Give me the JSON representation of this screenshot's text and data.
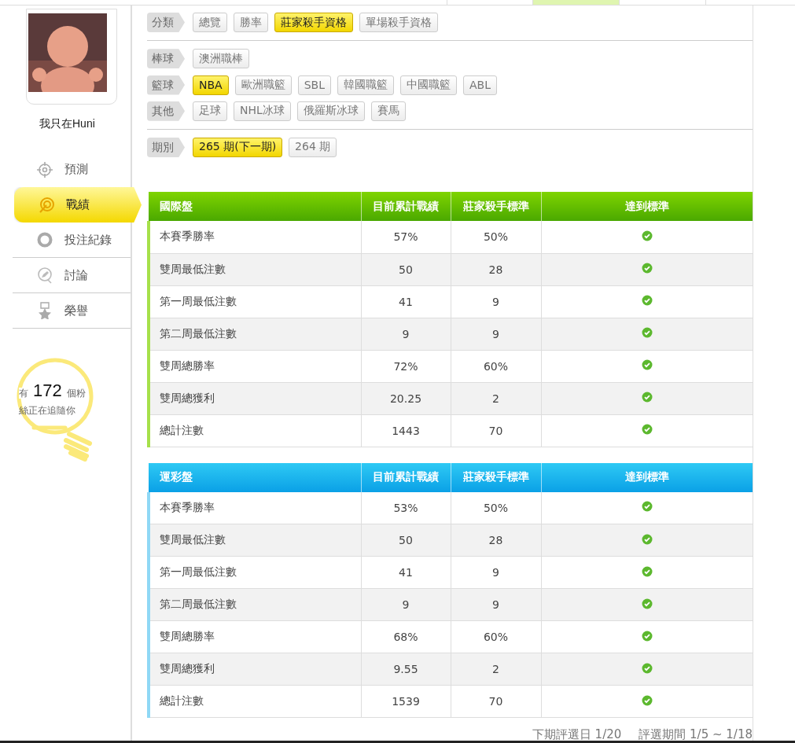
{
  "top_tabs": [
    {
      "selected": false
    },
    {
      "selected": true
    },
    {
      "selected": false
    },
    {
      "selected": false
    }
  ],
  "profile": {
    "name": "我只在Huni"
  },
  "menu": [
    {
      "label": "預測",
      "selected": false
    },
    {
      "label": "戰績",
      "selected": true
    },
    {
      "label": "投注紀錄",
      "selected": false
    },
    {
      "label": "討論",
      "selected": false
    },
    {
      "label": "榮譽",
      "selected": false
    }
  ],
  "followers": {
    "prefix": "有",
    "count": "172",
    "suffix": "個粉",
    "line2": "絲正在追隨你"
  },
  "filters": [
    {
      "label": "分類",
      "chips": [
        {
          "text": "總覽",
          "selected": false
        },
        {
          "text": "勝率",
          "selected": false
        },
        {
          "text": "莊家殺手資格",
          "selected": true
        },
        {
          "text": "單場殺手資格",
          "selected": false
        }
      ]
    },
    {
      "kind": "divider"
    },
    {
      "label": "棒球",
      "chips": [
        {
          "text": "澳洲職棒",
          "selected": false
        }
      ]
    },
    {
      "label": "籃球",
      "chips": [
        {
          "text": "NBA",
          "selected": true
        },
        {
          "text": "歐洲職籃",
          "selected": false
        },
        {
          "text": "SBL",
          "selected": false
        },
        {
          "text": "韓國職籃",
          "selected": false
        },
        {
          "text": "中國職籃",
          "selected": false
        },
        {
          "text": "ABL",
          "selected": false
        }
      ]
    },
    {
      "label": "其他",
      "chips": [
        {
          "text": "足球",
          "selected": false
        },
        {
          "text": "NHL冰球",
          "selected": false
        },
        {
          "text": "俄羅斯冰球",
          "selected": false
        },
        {
          "text": "賽馬",
          "selected": false
        }
      ]
    },
    {
      "kind": "divider"
    },
    {
      "label": "期別",
      "chips": [
        {
          "text": "265 期(下一期)",
          "selected": true
        },
        {
          "text": "264 期",
          "selected": false
        }
      ]
    }
  ],
  "tables": [
    {
      "kind": "international",
      "columns": [
        "國際盤",
        "目前累計戰績",
        "莊家殺手標準",
        "達到標準"
      ],
      "rows": [
        {
          "cells": [
            "本賽季勝率",
            "57%",
            "50%"
          ],
          "met": true
        },
        {
          "cells": [
            "雙周最低注數",
            "50",
            "28"
          ],
          "met": true
        },
        {
          "cells": [
            "第一周最低注數",
            "41",
            "9"
          ],
          "met": true
        },
        {
          "cells": [
            "第二周最低注數",
            "9",
            "9"
          ],
          "met": true
        },
        {
          "cells": [
            "雙周總勝率",
            "72%",
            "60%"
          ],
          "met": true
        },
        {
          "cells": [
            "雙周總獲利",
            "20.25",
            "2"
          ],
          "met": true
        },
        {
          "cells": [
            "總計注數",
            "1443",
            "70"
          ],
          "met": true
        }
      ]
    },
    {
      "kind": "lottery",
      "columns": [
        "運彩盤",
        "目前累計戰績",
        "莊家殺手標準",
        "達到標準"
      ],
      "rows": [
        {
          "cells": [
            "本賽季勝率",
            "53%",
            "50%"
          ],
          "met": true
        },
        {
          "cells": [
            "雙周最低注數",
            "50",
            "28"
          ],
          "met": true
        },
        {
          "cells": [
            "第一周最低注數",
            "41",
            "9"
          ],
          "met": true
        },
        {
          "cells": [
            "第二周最低注數",
            "9",
            "9"
          ],
          "met": true
        },
        {
          "cells": [
            "雙周總勝率",
            "68%",
            "60%"
          ],
          "met": true
        },
        {
          "cells": [
            "雙周總獲利",
            "9.55",
            "2"
          ],
          "met": true
        },
        {
          "cells": [
            "總計注數",
            "1539",
            "70"
          ],
          "met": true
        }
      ]
    }
  ],
  "footer": {
    "next_date": "下期評選日 1/20",
    "period": "評選期間 1/5 ~ 1/18"
  }
}
